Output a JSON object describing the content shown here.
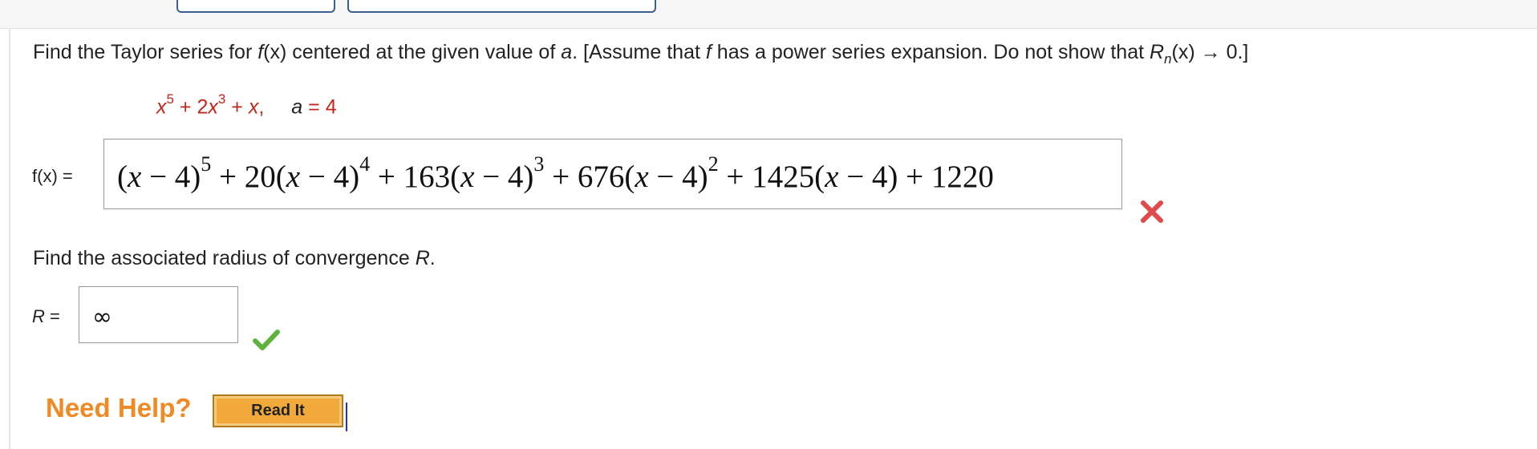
{
  "question": {
    "prefix": "Find the Taylor series for ",
    "fx": "f",
    "fx_arg": "(x)",
    "mid": " centered at the given value of ",
    "a": "a",
    "rest": ". [Assume that ",
    "f_again": "f",
    "rest2": " has a power series expansion. Do not show that ",
    "R": "R",
    "n": "n",
    "tail": "(x) → 0.]"
  },
  "given": {
    "x1": "x",
    "exp1": "5",
    "mid": " + 2",
    "x2": "x",
    "exp2": "3",
    "tail": " + ",
    "x3": "x",
    "comma": ",",
    "a_label": "a",
    "a_value": " = 4"
  },
  "fx_label": "f(x) =",
  "answer": {
    "t1": "(",
    "x": "x",
    "minus4": " − 4)",
    "e5": "5",
    "p20": " + 20(",
    "e4": "4",
    "p163": " + 163(",
    "e3": "3",
    "p676": " + 676(",
    "e2": "2",
    "p1425": " + 1425(",
    "end": " + 1220"
  },
  "radius": {
    "question": "Find the associated radius of convergence ",
    "R": "R",
    "dot": ".",
    "label": "R",
    "eq": " =",
    "value": "∞"
  },
  "help": {
    "need_help": "Need Help?",
    "read_it": "Read It"
  },
  "icons": {
    "wrong": "x-mark-icon",
    "correct": "checkmark-icon"
  },
  "colors": {
    "given_red": "#c0281e",
    "wrong_red": "#e04a4a",
    "correct_green": "#5fb23e",
    "help_orange": "#f08a24"
  }
}
